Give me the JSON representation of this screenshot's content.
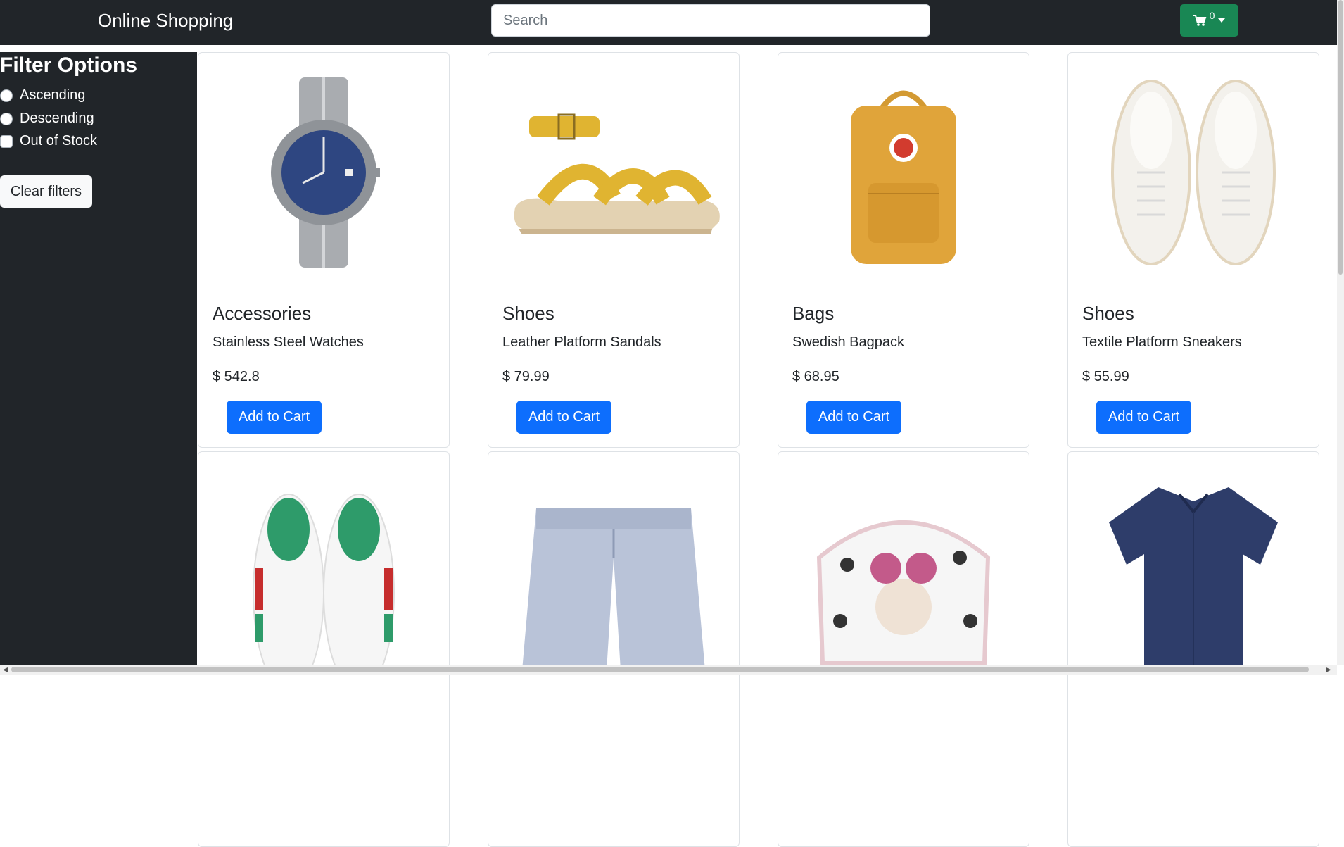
{
  "navbar": {
    "brand": "Online Shopping",
    "search_placeholder": "Search",
    "cart_count": "0",
    "cart_icon": "cart-icon",
    "caret_icon": "caret-down-icon"
  },
  "sidebar": {
    "title": "Filter Options",
    "options": [
      {
        "label": "Ascending",
        "type": "radio"
      },
      {
        "label": "Descending",
        "type": "radio"
      },
      {
        "label": "Out of Stock",
        "type": "checkbox"
      }
    ],
    "clear_label": "Clear filters"
  },
  "products": [
    {
      "category": "Accessories",
      "name": "Stainless Steel Watches",
      "price": "$ 542.8",
      "button": "Add to Cart",
      "image": "watch-image"
    },
    {
      "category": "Shoes",
      "name": "Leather Platform Sandals",
      "price": "$ 79.99",
      "button": "Add to Cart",
      "image": "sandal-image"
    },
    {
      "category": "Bags",
      "name": "Swedish Bagpack",
      "price": "$ 68.95",
      "button": "Add to Cart",
      "image": "backpack-image"
    },
    {
      "category": "Shoes",
      "name": "Textile Platform Sneakers",
      "price": "$ 55.99",
      "button": "Add to Cart",
      "image": "sneakers-image"
    },
    {
      "image": "striped-sneakers-image"
    },
    {
      "image": "shorts-image"
    },
    {
      "image": "polka-dot-bag-image"
    },
    {
      "image": "shirt-image"
    }
  ],
  "colors": {
    "navbar": "#212529",
    "cart_button": "#198754",
    "add_to_cart": "#0d6efd"
  }
}
